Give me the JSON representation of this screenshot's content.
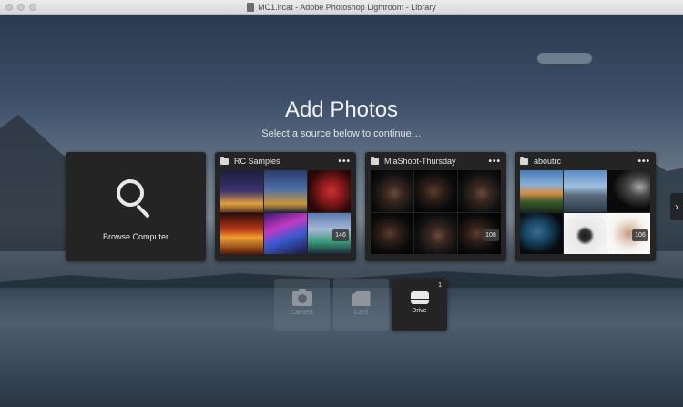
{
  "window": {
    "title": "MC1.lrcat - Adobe Photoshop Lightroom - Library"
  },
  "header": {
    "title": "Add Photos",
    "subtitle": "Select a source below to continue…"
  },
  "browse": {
    "label": "Browse Computer"
  },
  "folders": [
    {
      "name": "RC Samples",
      "more": "•••",
      "count": "146"
    },
    {
      "name": "MiaShoot-Thursday",
      "more": "•••",
      "count": "108"
    },
    {
      "name": "aboutrc",
      "more": "•••",
      "count": "106"
    }
  ],
  "devices": {
    "camera_label": "Camera",
    "card_label": "Card",
    "drive_label": "Drive",
    "drive_count": "1"
  },
  "nav": {
    "next_arrow": "›"
  },
  "colors": {
    "card_bg": "#242424",
    "text": "#e8e8e8"
  }
}
